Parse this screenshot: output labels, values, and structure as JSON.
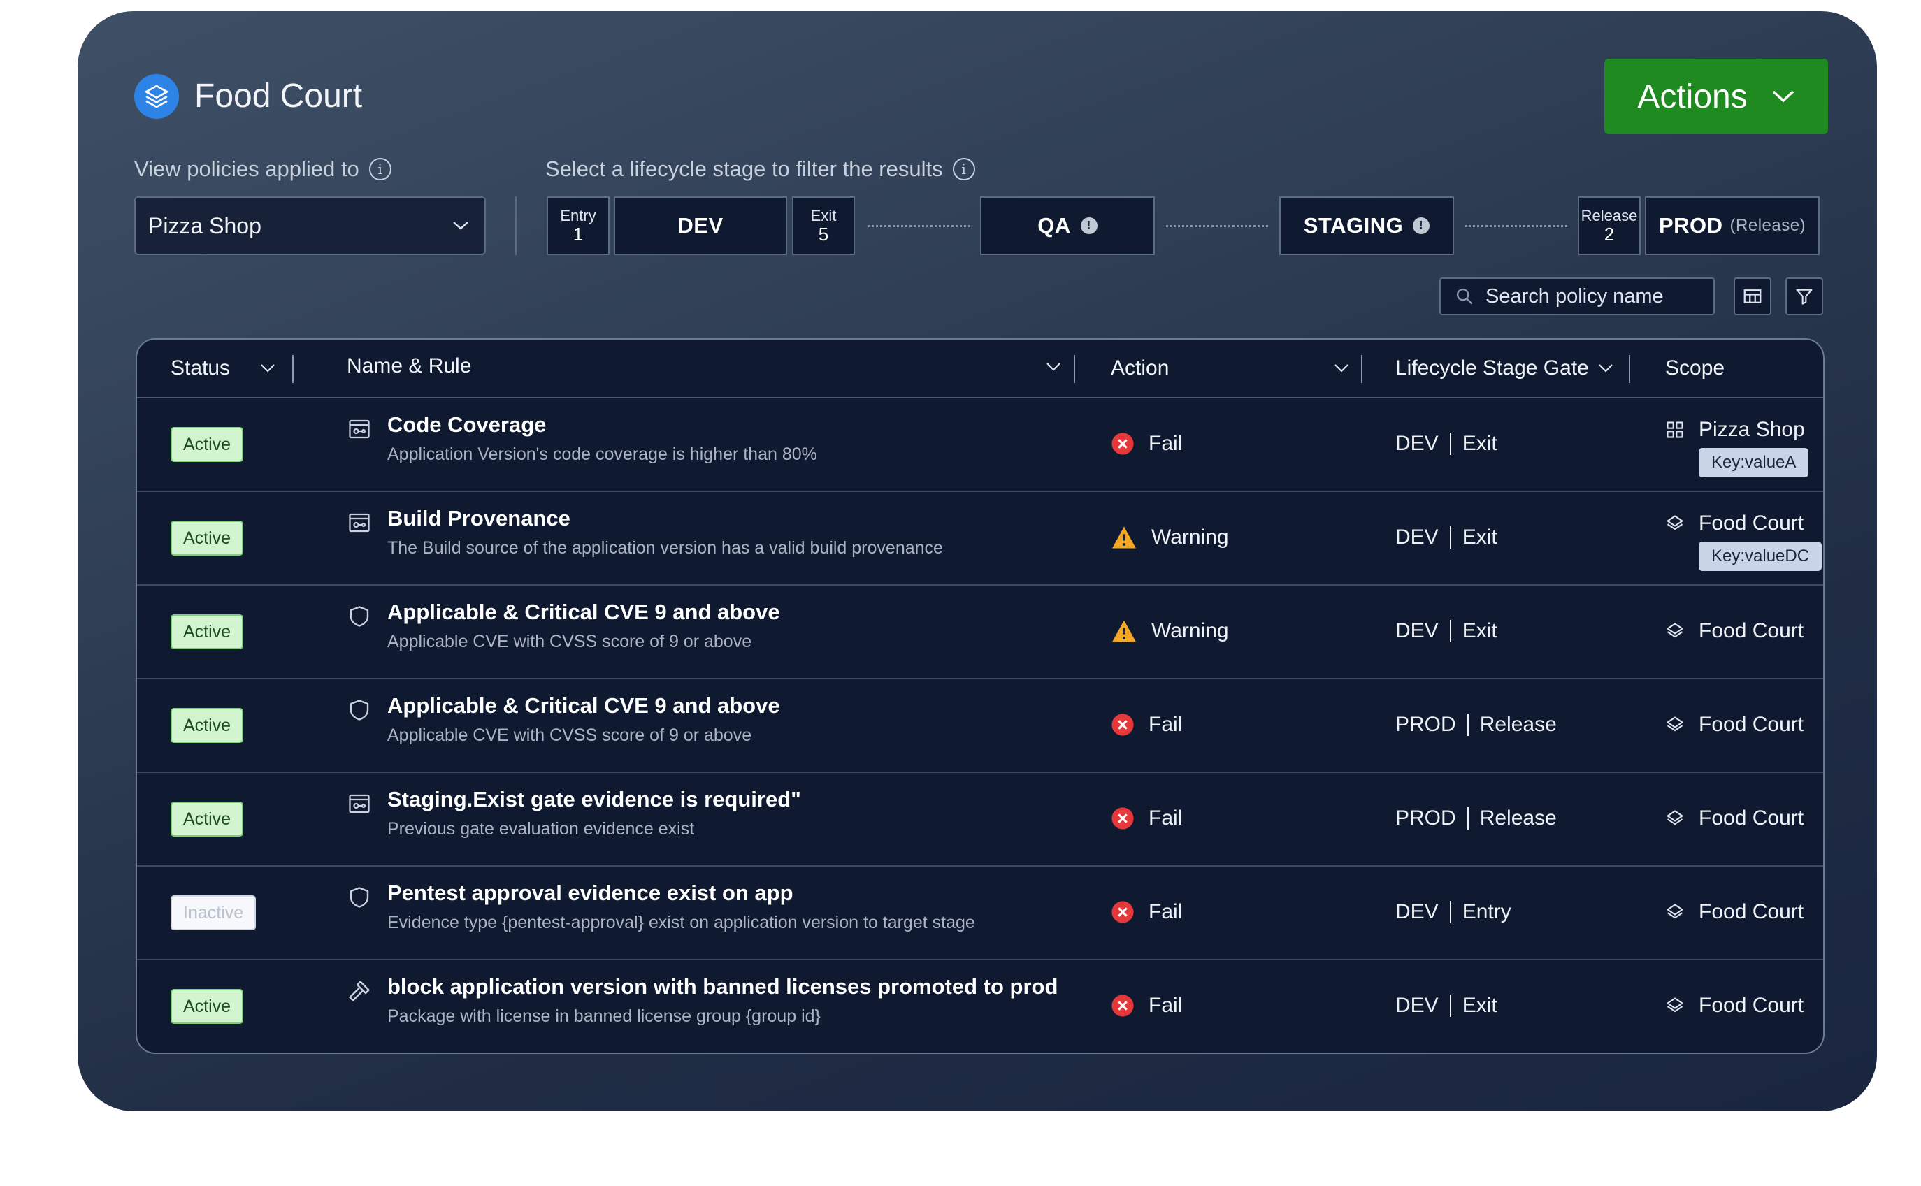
{
  "header": {
    "title": "Food Court",
    "actions_label": "Actions"
  },
  "filters": {
    "policies_label": "View policies applied to",
    "policies_selected": "Pizza Shop",
    "lifecycle_label": "Select a lifecycle stage to filter the results"
  },
  "stages": {
    "dev_entry_label": "Entry",
    "dev_entry_count": "1",
    "dev": "DEV",
    "dev_exit_label": "Exit",
    "dev_exit_count": "5",
    "qa": "QA",
    "staging": "STAGING",
    "prod_release_label": "Release",
    "prod_release_count": "2",
    "prod": "PROD",
    "prod_suffix": "(Release)"
  },
  "search": {
    "placeholder": "Search policy name"
  },
  "table": {
    "columns": [
      "Status",
      "Name & Rule",
      "Action",
      "Lifecycle Stage Gate",
      "Scope"
    ],
    "rows": [
      {
        "status": "Active",
        "name": "Code Coverage",
        "desc": "Application Version's code coverage is higher than 80%",
        "action": "Fail",
        "stage": "DEV",
        "gate": "Exit",
        "scope": "Pizza Shop",
        "key": "Key:valueA"
      },
      {
        "status": "Active",
        "name": "Build Provenance",
        "desc": "The Build source of the application version has a valid build provenance",
        "action": "Warning",
        "stage": "DEV",
        "gate": "Exit",
        "scope": "Food Court",
        "key": "Key:valueDC"
      },
      {
        "status": "Active",
        "name": "Applicable & Critical CVE 9 and above",
        "desc": "Applicable CVE with CVSS score of 9 or above",
        "action": "Warning",
        "stage": "DEV",
        "gate": "Exit",
        "scope": "Food Court"
      },
      {
        "status": "Active",
        "name": "Applicable & Critical CVE 9 and above",
        "desc": "Applicable CVE with CVSS score of 9 or above",
        "action": "Fail",
        "stage": "PROD",
        "gate": "Release",
        "scope": "Food Court"
      },
      {
        "status": "Active",
        "name": "Staging.Exist gate evidence is required\"",
        "desc": "Previous gate evaluation evidence exist",
        "action": "Fail",
        "stage": "PROD",
        "gate": "Release",
        "scope": "Food Court"
      },
      {
        "status": "Inactive",
        "name": "Pentest approval evidence exist on app",
        "desc": "Evidence type {pentest-approval} exist on application version to target stage",
        "action": "Fail",
        "stage": "DEV",
        "gate": "Entry",
        "scope": "Food Court"
      },
      {
        "status": "Active",
        "name": "block application version with banned licenses promoted to prod",
        "desc": "Package with license in banned license group {group id}",
        "action": "Fail",
        "stage": "DEV",
        "gate": "Exit",
        "scope": "Food Court"
      }
    ]
  },
  "icons": {
    "logo": "layers-icon",
    "rule_types": [
      "evidence-icon",
      "evidence-icon",
      "shield-icon",
      "shield-icon",
      "evidence-icon",
      "shield-icon",
      "gavel-icon"
    ],
    "scope_types": [
      "apps-grid-icon",
      "layers-icon",
      "layers-icon",
      "layers-icon",
      "layers-icon",
      "layers-icon",
      "layers-icon"
    ]
  },
  "colors": {
    "accent": "#1f8a1f",
    "fail": "#e5383b",
    "warning": "#f5a623",
    "active_badge": "#d2f5cf"
  }
}
